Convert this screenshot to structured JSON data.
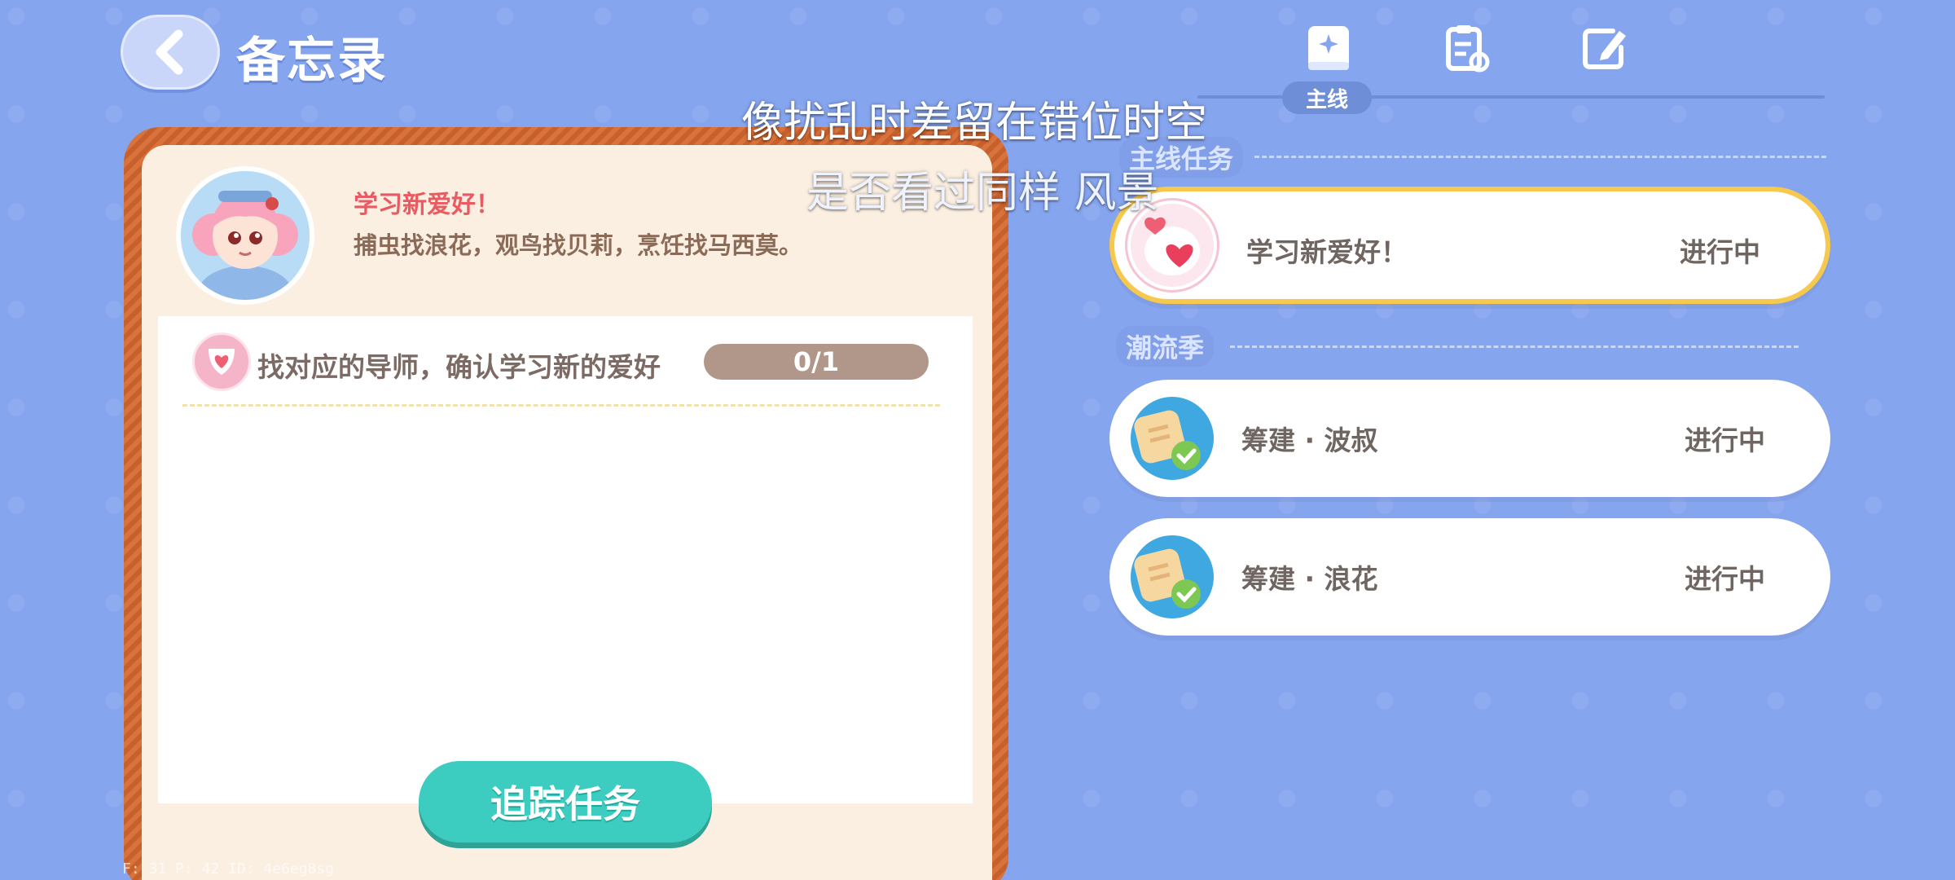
{
  "header": {
    "title": "备忘录"
  },
  "tabs": [
    {
      "id": "main",
      "label": "主线",
      "icon": "star-book-icon",
      "active": true
    },
    {
      "id": "second",
      "icon": "clipboard-refresh-icon"
    },
    {
      "id": "third",
      "icon": "pen-note-icon"
    }
  ],
  "lyrics": {
    "line1": "像扰乱时差留在错位时空",
    "line2": "是否看过同样 风景"
  },
  "detail": {
    "quest_name": "学习新爱好！",
    "quest_desc": "捕虫找浪花，观鸟找贝莉，烹饪找马西莫。",
    "task": {
      "text": "找对应的导师，确认学习新的爱好",
      "progress_text": "0/1",
      "progress_fraction": 0
    },
    "track_button": "追踪任务"
  },
  "sections": {
    "main": {
      "label": "主线任务",
      "items": [
        {
          "title": "学习新爱好！",
          "status": "进行中",
          "icon": "heart-icon",
          "selected": true
        }
      ]
    },
    "trend": {
      "label": "潮流季",
      "items": [
        {
          "title": "筹建 · 波叔",
          "status": "进行中",
          "icon": "note-check-icon"
        },
        {
          "title": "筹建 · 浪花",
          "status": "进行中",
          "icon": "note-check-icon"
        }
      ]
    }
  },
  "debug": "F: 31    P: 42    ID: 4e6eg8sg",
  "colors": {
    "background": "#86a5ef",
    "accent_teal": "#3dccc0",
    "selected_border": "#f6c84d",
    "quest_name_red": "#ea5a62"
  }
}
